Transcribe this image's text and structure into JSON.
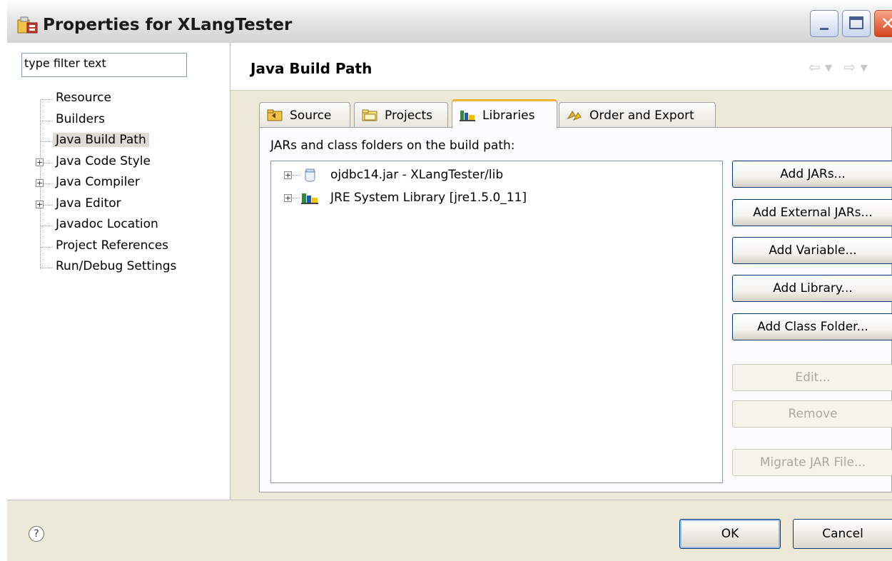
{
  "window": {
    "title": "Properties for XLangTester",
    "icons": {
      "app": "properties-app-icon",
      "minimize": "minimize-icon",
      "maximize": "maximize-icon",
      "close": "close-icon",
      "close_glyph": "✕"
    }
  },
  "sidebar": {
    "filter_value": "type filter text",
    "items": [
      {
        "label": "Resource",
        "expandable": false,
        "selected": false
      },
      {
        "label": "Builders",
        "expandable": false,
        "selected": false
      },
      {
        "label": "Java Build Path",
        "expandable": false,
        "selected": true
      },
      {
        "label": "Java Code Style",
        "expandable": true,
        "selected": false
      },
      {
        "label": "Java Compiler",
        "expandable": true,
        "selected": false
      },
      {
        "label": "Java Editor",
        "expandable": true,
        "selected": false
      },
      {
        "label": "Javadoc Location",
        "expandable": false,
        "selected": false
      },
      {
        "label": "Project References",
        "expandable": false,
        "selected": false
      },
      {
        "label": "Run/Debug Settings",
        "expandable": false,
        "selected": false
      }
    ],
    "expand_glyph": "+"
  },
  "page": {
    "title": "Java Build Path",
    "nav_back": "⇦ ▾",
    "nav_forward": "⇨ ▾"
  },
  "tabs": [
    {
      "label": "Source",
      "icon": "source-folder-icon",
      "active": false
    },
    {
      "label": "Projects",
      "icon": "projects-folder-icon",
      "active": false
    },
    {
      "label": "Libraries",
      "icon": "libraries-icon",
      "active": true
    },
    {
      "label": "Order and Export",
      "icon": "order-export-icon",
      "active": false
    }
  ],
  "libraries": {
    "heading": "JARs and class folders on the build path:",
    "entries": [
      {
        "label": "ojdbc14.jar - XLangTester/lib",
        "icon": "jar-icon"
      },
      {
        "label": "JRE System Library [jre1.5.0_11]",
        "icon": "jre-library-icon"
      }
    ],
    "expand_glyph": "+"
  },
  "buttons": [
    {
      "label": "Add JARs...",
      "enabled": true
    },
    {
      "label": "Add External JARs...",
      "enabled": true
    },
    {
      "label": "Add Variable...",
      "enabled": true
    },
    {
      "label": "Add Library...",
      "enabled": true
    },
    {
      "label": "Add Class Folder...",
      "enabled": true
    },
    {
      "label": "Edit...",
      "enabled": false
    },
    {
      "label": "Remove",
      "enabled": false
    },
    {
      "label": "Migrate JAR File...",
      "enabled": false
    }
  ],
  "footer": {
    "help_glyph": "?",
    "ok_label": "OK",
    "cancel_label": "Cancel"
  },
  "colors": {
    "dialog_bg": "#ece9d8",
    "active_tab_accent": "#f5b335",
    "button_border": "#003c74",
    "disabled_text": "#aca899",
    "library_icon_green": "#2e8b3a",
    "library_icon_yellow": "#f2c200",
    "folder_icon": "#f0c24a"
  }
}
